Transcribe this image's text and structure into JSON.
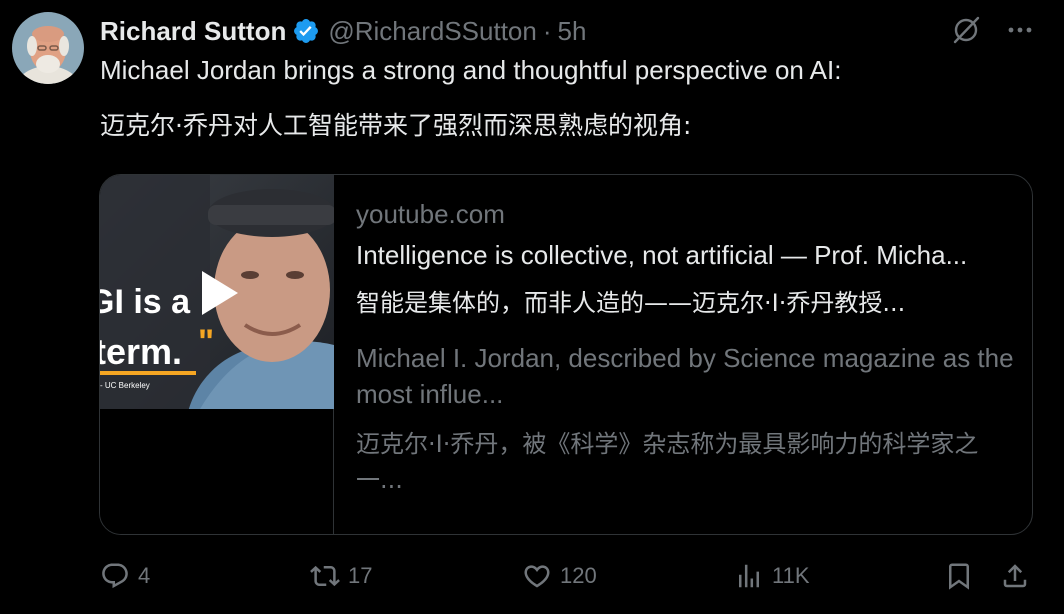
{
  "tweet": {
    "author": {
      "display_name": "Richard Sutton",
      "handle": "@RichardSSutton",
      "verified": true
    },
    "separator": "·",
    "timestamp": "5h",
    "text_en": "Michael Jordan brings a strong and thoughtful perspective on AI:",
    "text_zh": "迈克尔·乔丹对人工智能带来了强烈而深思熟虑的视角:",
    "card": {
      "domain": "youtube.com",
      "title": "Intelligence is collective, not artificial — Prof. Micha...",
      "title_zh": "智能是集体的，而非人造的——迈克尔·I·乔丹教授...",
      "description": "Michael I. Jordan, described by Science magazine as the most influe...",
      "description_zh": "迈克尔·I·乔丹，被《科学》杂志称为最具影响力的科学家之一...",
      "thumbnail_text": {
        "line1": "GI is a",
        "line2": "term.",
        "quote": "\"",
        "caption": "- UC Berkeley"
      }
    },
    "actions": {
      "replies": "4",
      "reposts": "17",
      "likes": "120",
      "views": "11K"
    },
    "icons": [
      "verified-badge-icon",
      "grok-icon",
      "more-icon",
      "play-icon",
      "reply-icon",
      "repost-icon",
      "like-icon",
      "views-icon",
      "bookmark-icon",
      "share-icon"
    ],
    "colors": {
      "background": "#000000",
      "primary_text": "#e7e9ea",
      "secondary_text": "#71767b",
      "border": "#2f3336",
      "verified": "#1d9bf0",
      "accent_orange": "#f5a623"
    }
  }
}
